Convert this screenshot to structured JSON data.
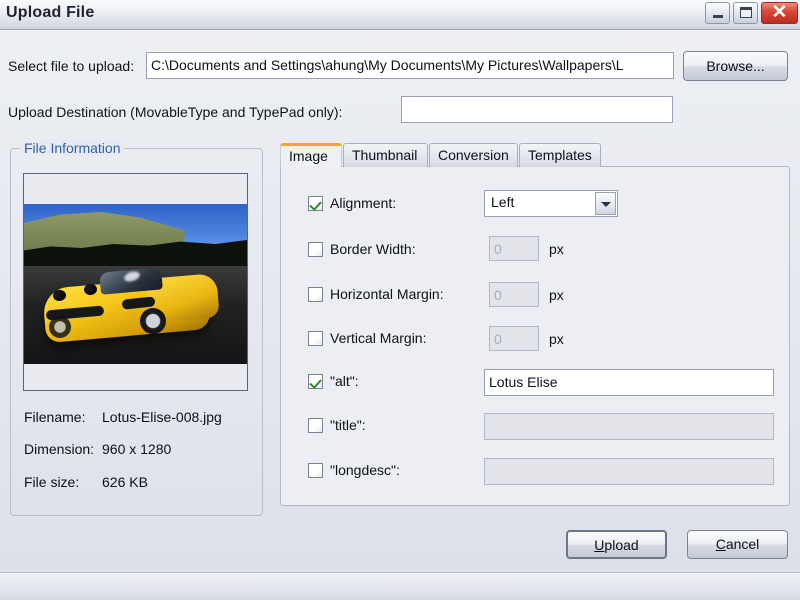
{
  "window": {
    "title": "Upload File",
    "buttons": {
      "minimize": "minimize",
      "maximize": "maximize",
      "close": "close"
    }
  },
  "form": {
    "select_file_label": "Select file to upload:",
    "file_path_value": "C:\\Documents and Settings\\ahung\\My Documents\\My Pictures\\Wallpapers\\L",
    "file_path_placeholder": "",
    "browse_label": "Browse...",
    "browse_accesskey": "B",
    "upload_destination_label": "Upload Destination (MovableType and TypePad only):",
    "upload_destination_value": "",
    "upload_destination_placeholder": ""
  },
  "file_information": {
    "group_title": "File Information",
    "preview_alt": "Yellow Lotus Elise convertible on a racetrack",
    "rows": [
      {
        "key": "Filename:",
        "value": "Lotus-Elise-008.jpg"
      },
      {
        "key": "Dimension:",
        "value": "960 x 1280"
      },
      {
        "key": "File size:",
        "value": "626 KB"
      }
    ]
  },
  "tabs": [
    {
      "label": "Image",
      "active": true
    },
    {
      "label": "Thumbnail",
      "active": false
    },
    {
      "label": "Conversion",
      "active": false
    },
    {
      "label": "Templates",
      "active": false
    }
  ],
  "image_tab": {
    "alignment": {
      "label": "Alignment:",
      "checked": true,
      "value": "Left",
      "options": [
        "Left"
      ]
    },
    "border_width": {
      "label": "Border Width:",
      "checked": false,
      "value": "0",
      "unit": "px"
    },
    "horizontal_margin": {
      "label": "Horizontal Margin:",
      "checked": false,
      "value": "0",
      "unit": "px"
    },
    "vertical_margin": {
      "label": "Vertical Margin:",
      "checked": false,
      "value": "0",
      "unit": "px"
    },
    "alt": {
      "label": "\"alt\":",
      "checked": true,
      "value": "Lotus Elise",
      "placeholder": ""
    },
    "title": {
      "label": "\"title\":",
      "checked": false,
      "value": "",
      "placeholder": ""
    },
    "longdesc": {
      "label": "\"longdesc\":",
      "checked": false,
      "value": "",
      "placeholder": ""
    }
  },
  "actions": {
    "upload_label": "Upload",
    "upload_accesskey": "U",
    "cancel_label": "Cancel",
    "cancel_accesskey": "C"
  },
  "statusbar": {
    "text": ""
  },
  "colors": {
    "accent_tab": "#f0a72a",
    "group_title": "#2f5fae",
    "check": "#2c8a2c",
    "close_button": "#b92d1e"
  }
}
